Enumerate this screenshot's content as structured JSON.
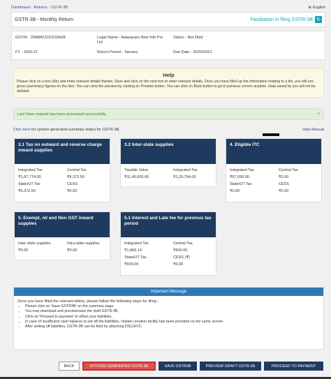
{
  "breadcrumb": {
    "dashboard": "Dashboard",
    "returns": "Returns",
    "current": "GSTR-3B"
  },
  "lang": {
    "label": "English"
  },
  "title": {
    "text": "GSTR-3B - Monthly Return",
    "facilitation": "Facilitation in filing GSTR-3B"
  },
  "info": {
    "gstin": "GSTIN - 29ABACD1191FAZK",
    "legal_name": "Legal Name - Adaequare New Info Pvt Ltd",
    "status": "Status - Not Filed",
    "fy": "FY - 2020-21",
    "period": "Return Period - January",
    "due": "Due Date - 20/02/2021"
  },
  "help": {
    "title": "Help",
    "text": "Please click on a box (tile) and enter relevant details therein. Save and click on the next box to enter relevant details. Once you have filled up the information relating to a tile, you will see gross (summary) figures on the tiles. You can view the preview by clicking on Preview button. You can click on Back button to go to previous screen anytime. Data saved by you will not be deleted."
  },
  "alert": {
    "text": "Last Save request has been processed successfully.",
    "close": "×"
  },
  "links": {
    "click_here": "Click here",
    "rest": " for system generated summary status for GSTR-3B.",
    "help_manual": "Help Manual"
  },
  "tiles": {
    "t31": {
      "title": "3.1 Tax on outward and reverse charge inward supplies",
      "l1": "Integrated Tax",
      "v1": "₹1,87,774.00",
      "l2": "Central Tax",
      "v2": "₹5,372.50",
      "l3": "State/UT Tax",
      "v3": "₹5,372.50",
      "l4": "CESS",
      "v4": "₹0.00"
    },
    "t32": {
      "title": "3.2 Inter-state supplies",
      "l1": "Taxable Value",
      "v1": "₹11,45,600.00",
      "l2": "Integrated Tax",
      "v2": "₹1,29,794.00"
    },
    "t4": {
      "title": "4. Eligible ITC",
      "l1": "Integrated Tax",
      "v1": "₹57,090.00",
      "l2": "Central Tax",
      "v2": "₹0.00",
      "l3": "State/UT Tax",
      "v3": "₹0.00",
      "l4": "CESS",
      "v4": "₹0.00"
    },
    "t5": {
      "title": "5. Exempt, nil and Non GST inward supplies",
      "l1": "Inter-state supplies",
      "v1": "₹0.00",
      "l2": "Intra-state supplies",
      "v2": "₹0.00"
    },
    "t51": {
      "title": "5.1 Interest and Late fee for previous tax period",
      "l1": "Integrated Tax",
      "v1": "₹1,866.14",
      "l2": "Central Tax",
      "v2": "₹500.00",
      "l3": "State/UT Tax",
      "v3": "₹500.00",
      "l4": "CESS (₹)",
      "v4": "₹0.00"
    }
  },
  "important": {
    "title": "Important Message",
    "intro": "Once you have filled the relevant tables, please follow the following steps for filing:-",
    "steps": [
      "Please click on 'Save GSTR3B' on the summary page.",
      "You may download and preview/save the draft GSTR-3B.",
      "Click on 'Proceed to payment' to offset your liabilities.",
      "In case of insufficient cash balance to set off the liabilities, challan creation facility has been provided on the same screen.",
      "After setting off liabilities, GSTR-3B can be filed by attaching DSC/EVC."
    ]
  },
  "buttons": {
    "back": "BACK",
    "system": "SYSTEM GENERATED GSTR-3B",
    "save": "SAVE GSTR3B",
    "preview": "PREVIEW DRAFT GSTR-3B",
    "proceed": "PROCEED TO PAYMENT"
  },
  "colors": {
    "tile_header": "#1f3a5f",
    "accent": "#17a2b8",
    "highlight": "#d9534f"
  }
}
